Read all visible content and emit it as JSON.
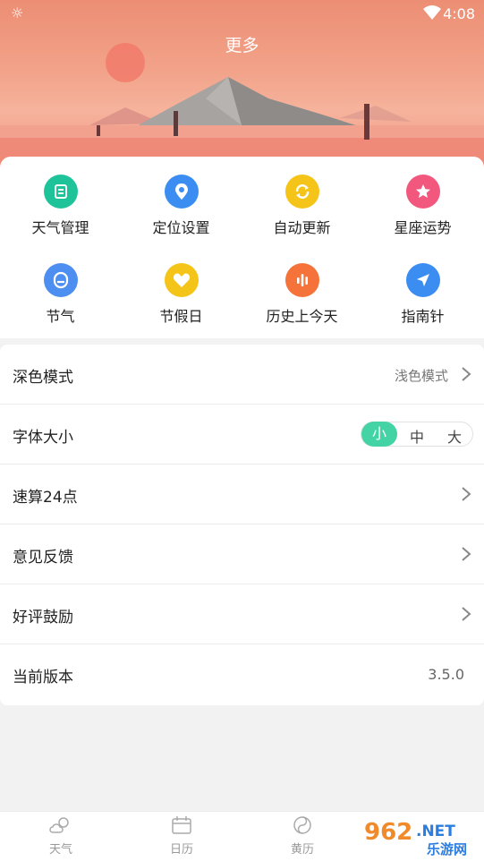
{
  "statusbar": {
    "time": "4:08"
  },
  "header": {
    "title": "更多"
  },
  "grid": [
    {
      "label": "天气管理",
      "icon": "list-icon",
      "color": "#1fc39a"
    },
    {
      "label": "定位设置",
      "icon": "location-pin-icon",
      "color": "#3b8df2"
    },
    {
      "label": "自动更新",
      "icon": "refresh-icon",
      "color": "#f5c418"
    },
    {
      "label": "星座运势",
      "icon": "star-icon",
      "color": "#f2587e"
    },
    {
      "label": "节气",
      "icon": "letter-a-icon",
      "color": "#4d8ff0"
    },
    {
      "label": "节假日",
      "icon": "heart-icon",
      "color": "#f5c418"
    },
    {
      "label": "历史上今天",
      "icon": "voice-bars-icon",
      "color": "#f5733a"
    },
    {
      "label": "指南针",
      "icon": "compass-arrow-icon",
      "color": "#3b8df2"
    }
  ],
  "settings": {
    "dark_mode": {
      "label": "深色模式",
      "value": "浅色模式"
    },
    "font_size": {
      "label": "字体大小",
      "options": [
        "小",
        "中",
        "大"
      ],
      "selected": "小"
    },
    "game24": {
      "label": "速算24点"
    },
    "feedback": {
      "label": "意见反馈"
    },
    "rating": {
      "label": "好评鼓励"
    },
    "version": {
      "label": "当前版本",
      "value": "3.5.0"
    }
  },
  "tabs": [
    {
      "label": "天气",
      "icon": "weather-icon"
    },
    {
      "label": "日历",
      "icon": "calendar-icon"
    },
    {
      "label": "黄历",
      "icon": "yin-yang-icon"
    }
  ],
  "watermark": {
    "brand": "962",
    "domain": ".NET",
    "site": "乐游网"
  }
}
